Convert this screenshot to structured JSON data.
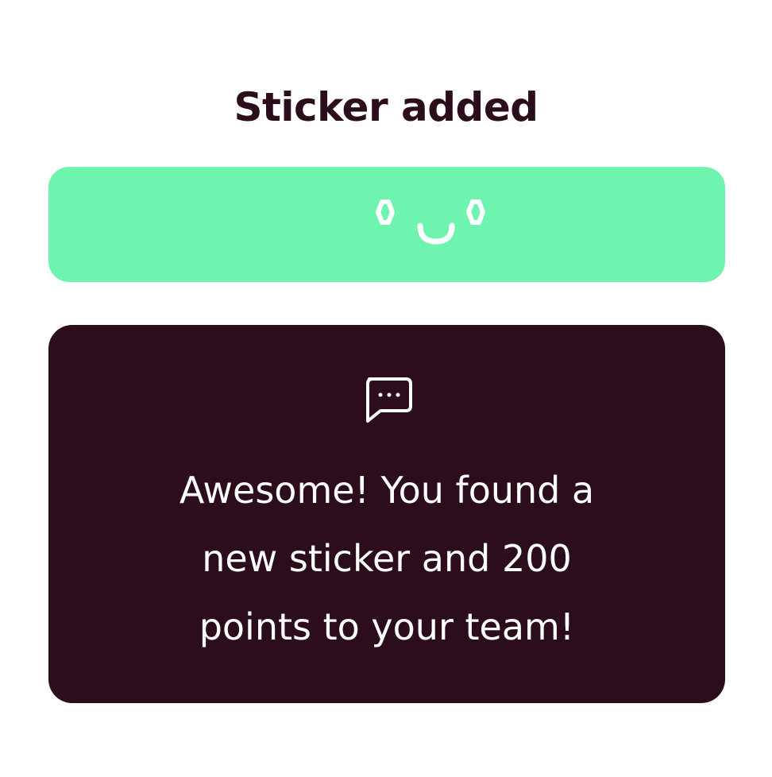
{
  "header": {
    "title": "Sticker added"
  },
  "sticker": {
    "icon": "happy-face-icon",
    "background_color": "#6ff4b0"
  },
  "message": {
    "icon": "chat-bubble-icon",
    "lines": [
      "Awesome! You found a",
      "new sticker and 200",
      "points to your team!"
    ],
    "background_color": "#2c0d1c"
  }
}
